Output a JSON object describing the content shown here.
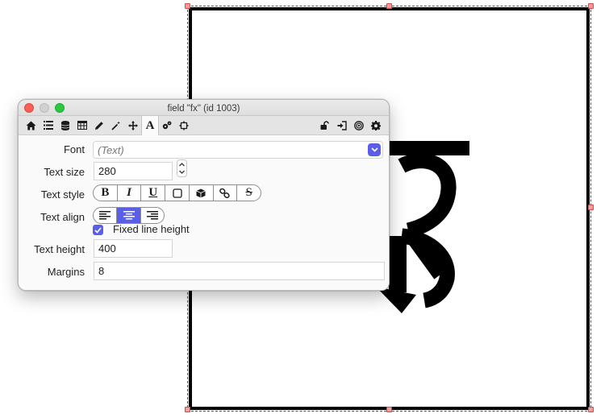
{
  "window": {
    "title": "field \"fx\" (id 1003)"
  },
  "toolbar": {
    "left_icons": [
      "home-icon",
      "list-icon",
      "database-icon",
      "table-icon",
      "pencil-icon",
      "magic-wand-icon",
      "move-icon",
      "text-icon",
      "gears-icon",
      "resize-icon"
    ],
    "right_icons": [
      "lock-icon",
      "sign-in-icon",
      "target-icon",
      "gear-icon"
    ],
    "active_icon": "text-icon",
    "text_tab_glyph": "A"
  },
  "form": {
    "font": {
      "label": "Font",
      "value": "(Text)"
    },
    "text_size": {
      "label": "Text size",
      "value": "280"
    },
    "text_style": {
      "label": "Text style",
      "buttons": [
        {
          "name": "bold",
          "glyph": "B"
        },
        {
          "name": "italic",
          "glyph": "I"
        },
        {
          "name": "underline",
          "glyph": "U"
        },
        {
          "name": "box",
          "glyph": ""
        },
        {
          "name": "3d-box",
          "glyph": ""
        },
        {
          "name": "link",
          "glyph": ""
        },
        {
          "name": "strikeout",
          "glyph": "S"
        }
      ]
    },
    "text_align": {
      "label": "Text align",
      "options": [
        "left",
        "center",
        "right"
      ],
      "selected": "center"
    },
    "fixed_line_height": {
      "label": "Fixed line height",
      "checked": true
    },
    "text_height": {
      "label": "Text height",
      "value": "400"
    },
    "margins": {
      "label": "Margins",
      "value": "8"
    }
  },
  "canvas": {
    "glyph_description": "large black glyph rendered in selected field",
    "accent_color": "#5b5ee8"
  }
}
